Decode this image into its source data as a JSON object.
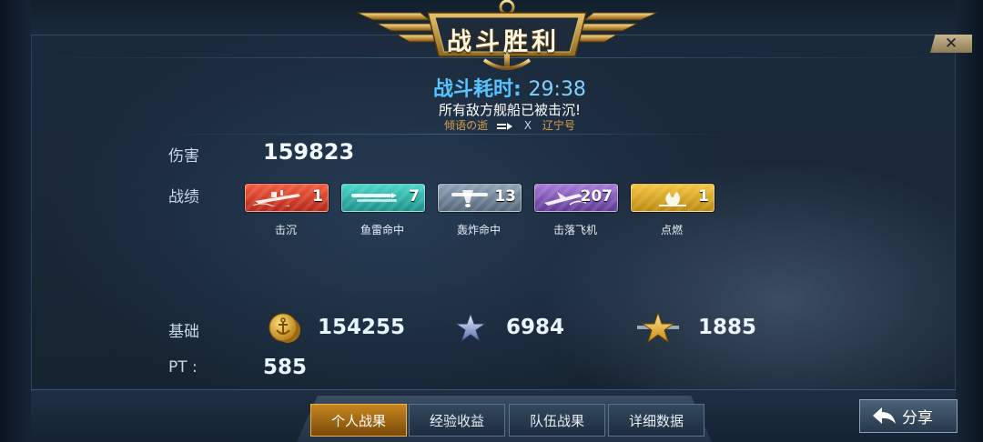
{
  "header": {
    "title": "战斗胜利",
    "close_symbol": "✕"
  },
  "battle": {
    "time_label": "战斗耗时:",
    "time_value": "29:38",
    "result_text": "所有敌方舰船已被击沉!",
    "player_name": "倾语の逝",
    "vs_separator": "X",
    "opponent_name": "辽宁号"
  },
  "damage": {
    "label": "伤害",
    "value": "159823"
  },
  "record": {
    "label": "战绩",
    "items": [
      {
        "caption": "击沉",
        "count": "1",
        "color": "#d63a26",
        "icon": "sinking-ship-icon"
      },
      {
        "caption": "鱼雷命中",
        "count": "7",
        "color": "#2eb3ad",
        "icon": "torpedo-icon"
      },
      {
        "caption": "轰炸命中",
        "count": "13",
        "color": "#6f8398",
        "icon": "bomb-plane-icon"
      },
      {
        "caption": "击落飞机",
        "count": "207",
        "color": "#7d54b5",
        "icon": "shot-down-plane-icon"
      },
      {
        "caption": "点燃",
        "count": "1",
        "color": "#d6a623",
        "icon": "fire-icon"
      }
    ]
  },
  "base": {
    "label": "基础",
    "rewards": [
      {
        "icon": "gold-coin-anchor-icon",
        "value": "154255"
      },
      {
        "icon": "silver-star-icon",
        "value": "6984"
      },
      {
        "icon": "gold-star-icon",
        "value": "1885"
      }
    ]
  },
  "pt": {
    "label": "PT :",
    "value": "585"
  },
  "tabs": [
    {
      "label": "个人战果",
      "active": true
    },
    {
      "label": "经验收益",
      "active": false
    },
    {
      "label": "队伍战果",
      "active": false
    },
    {
      "label": "详细数据",
      "active": false
    }
  ],
  "share_button": {
    "label": "分享"
  },
  "colors": {
    "accent_blue": "#56c4ff",
    "active_tab": "#c7861e",
    "gold": "#d6a623"
  }
}
